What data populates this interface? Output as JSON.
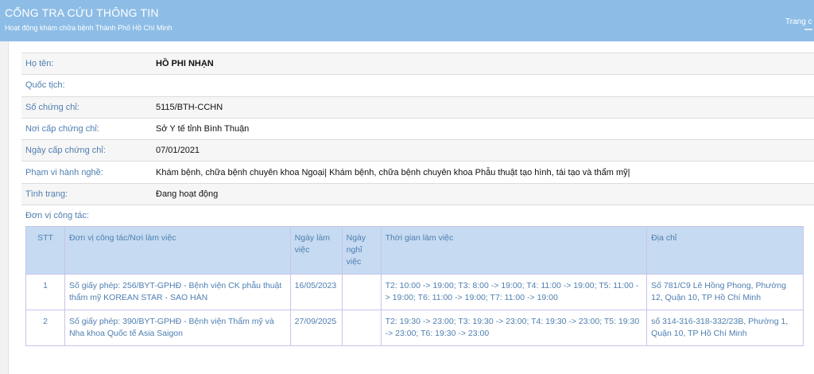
{
  "header": {
    "title": "CỔNG TRA CỨU THÔNG TIN",
    "subtitle": "Hoạt động khám chữa bệnh Thành Phố Hồ Chí Minh",
    "right_link": "Trang c"
  },
  "info": [
    {
      "label": "Họ tên:",
      "value": "HỒ PHI NHẠN"
    },
    {
      "label": "Quốc tịch:",
      "value": ""
    },
    {
      "label": "Số chứng chỉ:",
      "value": "5115/BTH-CCHN"
    },
    {
      "label": "Nơi cấp chứng chỉ:",
      "value": "Sở Y tế tỉnh Bình Thuận"
    },
    {
      "label": "Ngày cấp chứng chỉ:",
      "value": "07/01/2021"
    },
    {
      "label": "Phạm vi hành nghề:",
      "value": "Khám bệnh, chữa bệnh chuyên khoa Ngoại| Khám bệnh, chữa bệnh chuyên khoa Phẫu thuật tạo hình, tái tạo và thẩm mỹ|"
    },
    {
      "label": "Tình trạng:",
      "value": "Đang hoạt động"
    }
  ],
  "workplace": {
    "label": "Đơn vị công tác:",
    "columns": [
      "STT",
      "Đơn vị công tác/Nơi làm việc",
      "Ngày làm việc",
      "Ngày nghỉ việc",
      "Thời gian làm việc",
      "Địa chỉ"
    ],
    "rows": [
      {
        "stt": "1",
        "unit": "Số giấy phép: 256/BYT-GPHĐ - Bệnh viện CK phẫu thuật thẩm mỹ KOREAN STAR - SAO HÀN",
        "start": "16/05/2023",
        "end": "",
        "hours": "T2: 10:00 -> 19:00; T3: 8:00 -> 19:00; T4: 11:00 -> 19:00; T5: 11:00 -> 19:00; T6: 11:00 -> 19:00; T7: 11:00 -> 19:00",
        "address": "Số 781/C9 Lê Hồng Phong, Phường 12, Quận 10, TP Hồ Chí Minh"
      },
      {
        "stt": "2",
        "unit": "Số giấy phép: 390/BYT-GPHĐ - Bệnh viện Thẩm mỹ và Nha khoa Quốc tế Asia Saigon",
        "start": "27/09/2025",
        "end": "",
        "hours": "T2: 19:30 -> 23:00; T3: 19:30 -> 23:00; T4: 19:30 -> 23:00; T5: 19:30 -> 23:00; T6: 19:30 -> 23:00",
        "address": "số 314-316-318-332/23B, Phường 1, Quận 10, TP Hồ Chí Minh"
      }
    ]
  }
}
